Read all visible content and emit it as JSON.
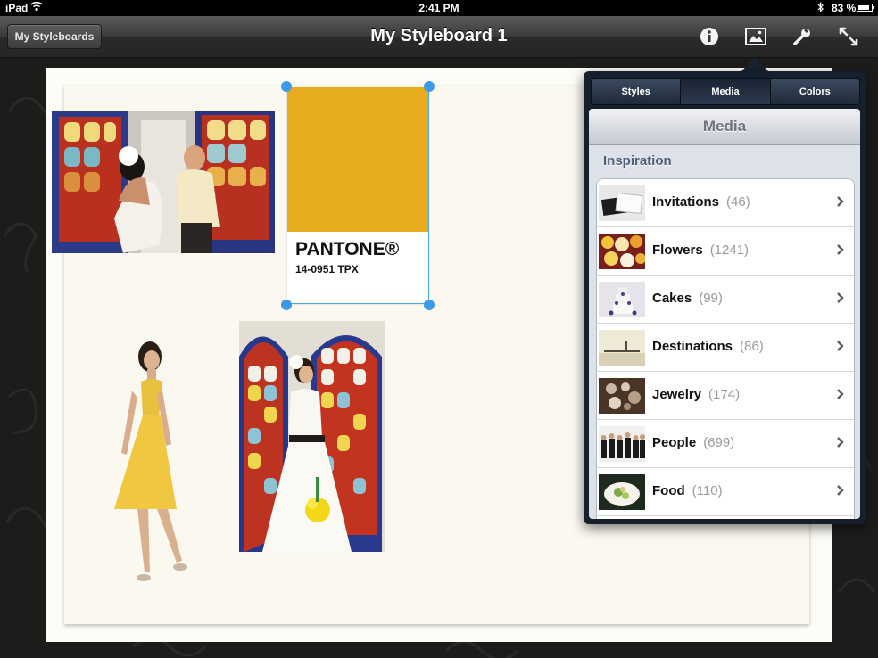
{
  "status_bar": {
    "carrier": "iPad",
    "time": "2:41 PM",
    "battery_label": "83 %",
    "battery_level": 0.83
  },
  "nav_bar": {
    "back_label": "My Styleboards",
    "title": "My Styleboard 1",
    "tools": [
      "info-icon",
      "image-icon",
      "wrench-icon",
      "fullscreen-icon"
    ]
  },
  "board": {
    "pantone": {
      "brand": "PANTONE®",
      "code": "14-0951 TPX",
      "color": "#e6ab1f"
    }
  },
  "popover": {
    "tabs": [
      "Styles",
      "Media",
      "Colors"
    ],
    "active_tab": "Media",
    "header": "Media",
    "section": "Inspiration",
    "items": [
      {
        "label": "Invitations",
        "count": "(46)"
      },
      {
        "label": "Flowers",
        "count": "(1241)"
      },
      {
        "label": "Cakes",
        "count": "(99)"
      },
      {
        "label": "Destinations",
        "count": "(86)"
      },
      {
        "label": "Jewelry",
        "count": "(174)"
      },
      {
        "label": "People",
        "count": "(699)"
      },
      {
        "label": "Food",
        "count": "(110)"
      }
    ]
  }
}
